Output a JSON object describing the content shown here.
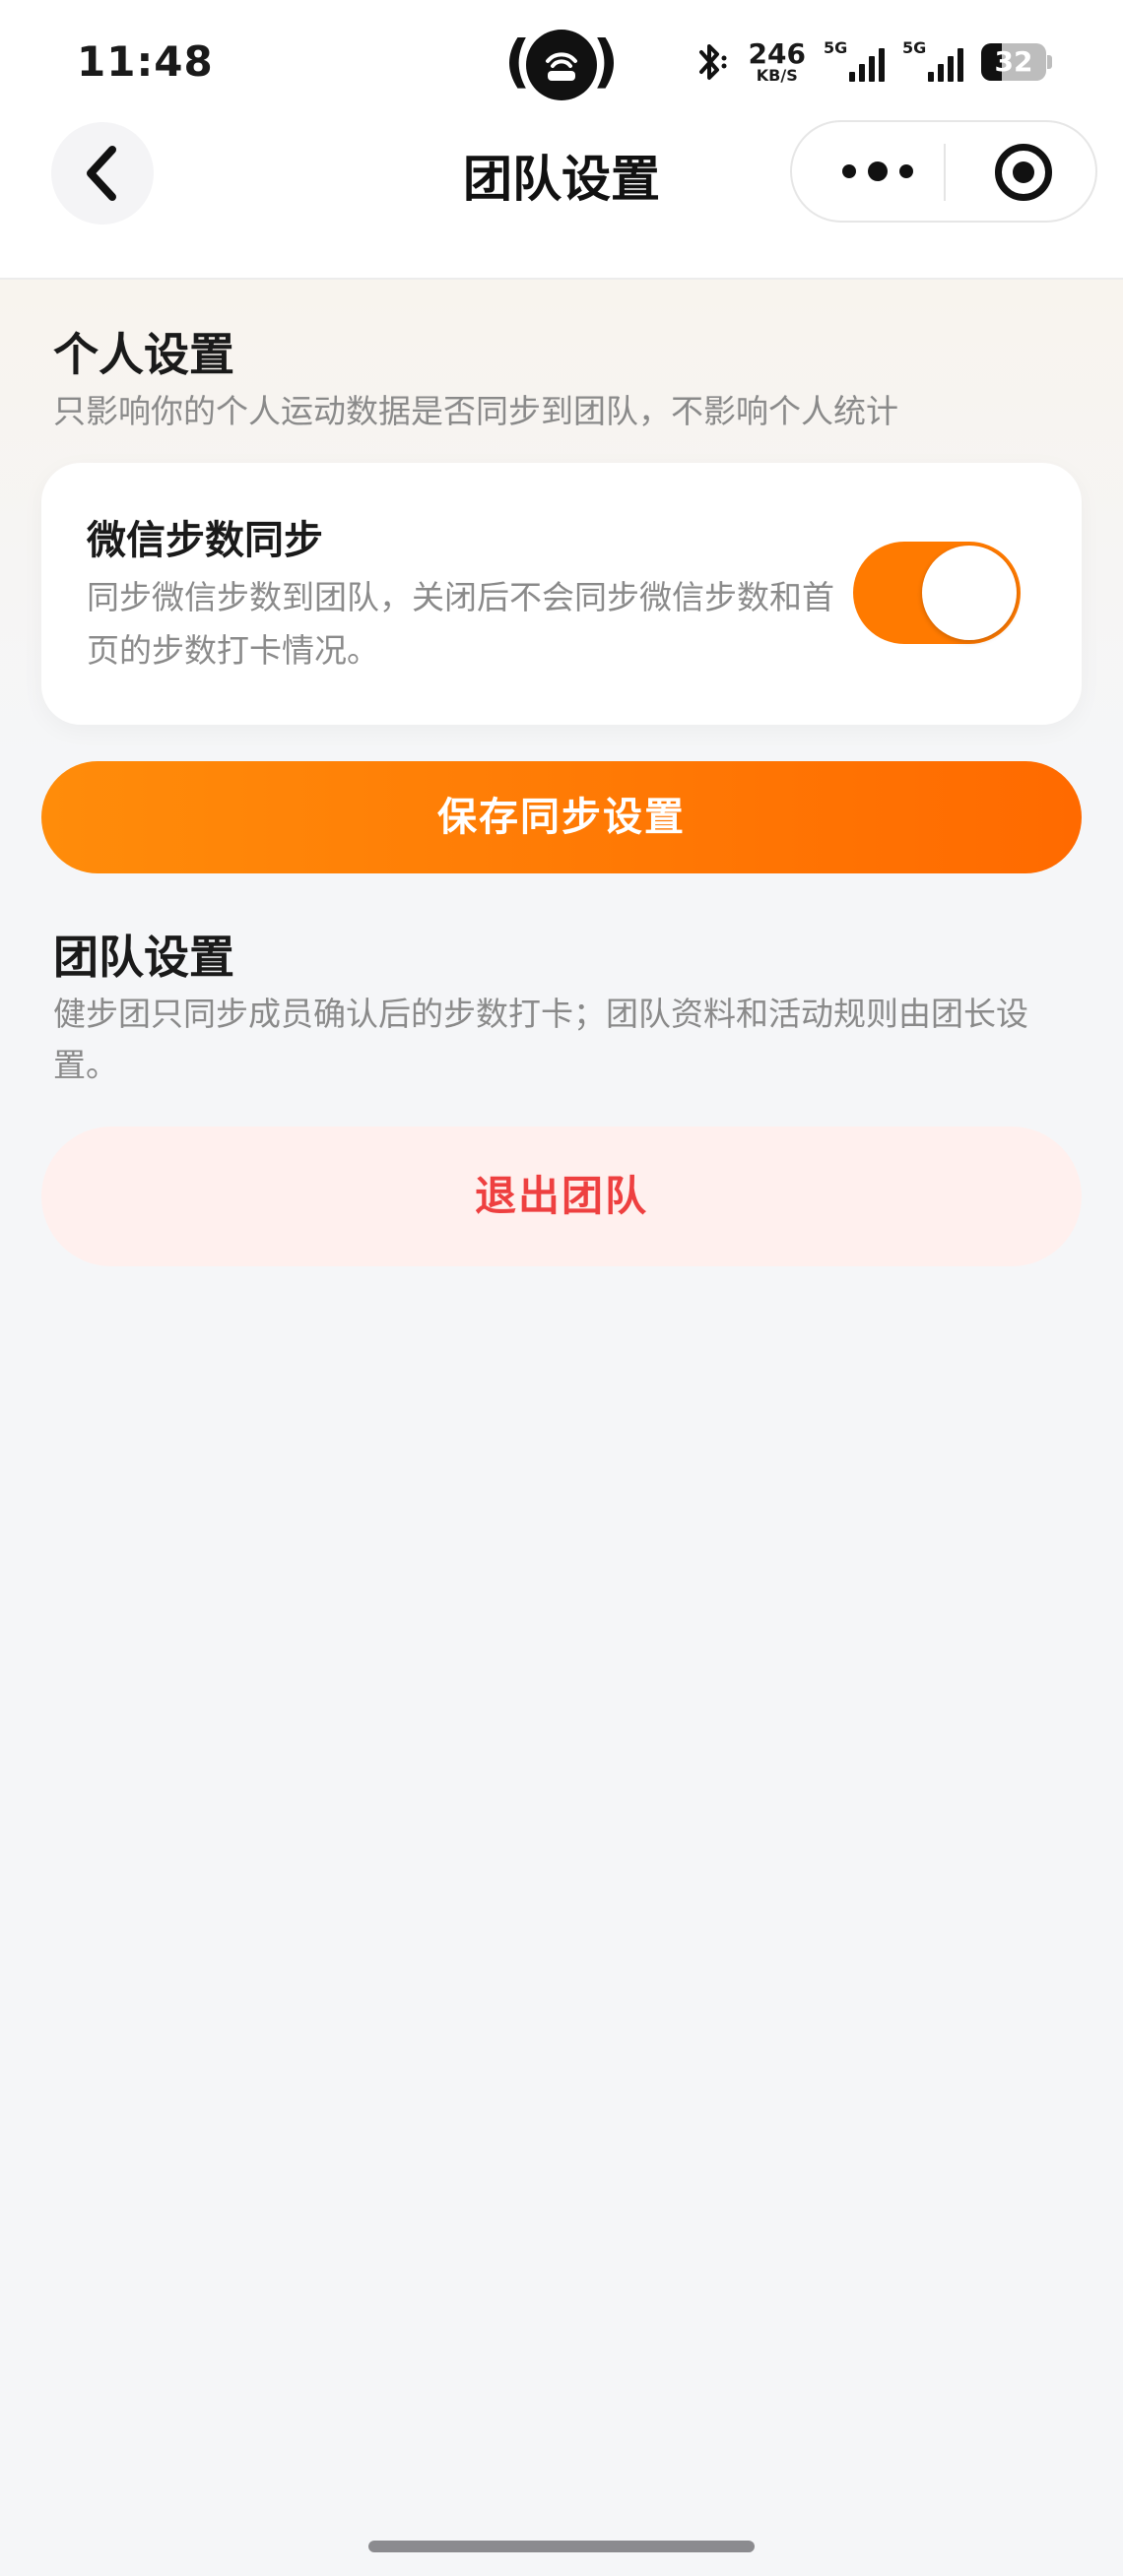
{
  "status_bar": {
    "time": "11:48",
    "network_speed": "246",
    "network_speed_unit": "KB/S",
    "signal_1_tag": "5G",
    "signal_2_tag": "5G",
    "battery_level": "32",
    "battery_fraction": 0.32,
    "icons": [
      "hotspot-icon",
      "bluetooth-icon",
      "signal-icon",
      "battery-icon"
    ]
  },
  "nav_bar": {
    "title": "团队设置",
    "back_icon": "chevron-left-icon",
    "more_icon": "more-dots-icon",
    "close_icon": "target-circle-icon"
  },
  "personal": {
    "title": "个人设置",
    "description": "只影响你的个人运动数据是否同步到团队，不影响个人统计",
    "wechat_sync": {
      "title": "微信步数同步",
      "description": "同步微信步数到团队，关闭后不会同步微信步数和首页的步数打卡情况。",
      "enabled": true
    },
    "save_label": "保存同步设置"
  },
  "team": {
    "title": "团队设置",
    "description": "健步团只同步成员确认后的步数打卡；团队资料和活动规则由团长设置。",
    "quit_label": "退出团队"
  },
  "colors": {
    "accent": "#ff7a00",
    "danger": "#ee4040",
    "danger_bg": "#fff0ee",
    "page_bg": "#f5f6f8"
  }
}
